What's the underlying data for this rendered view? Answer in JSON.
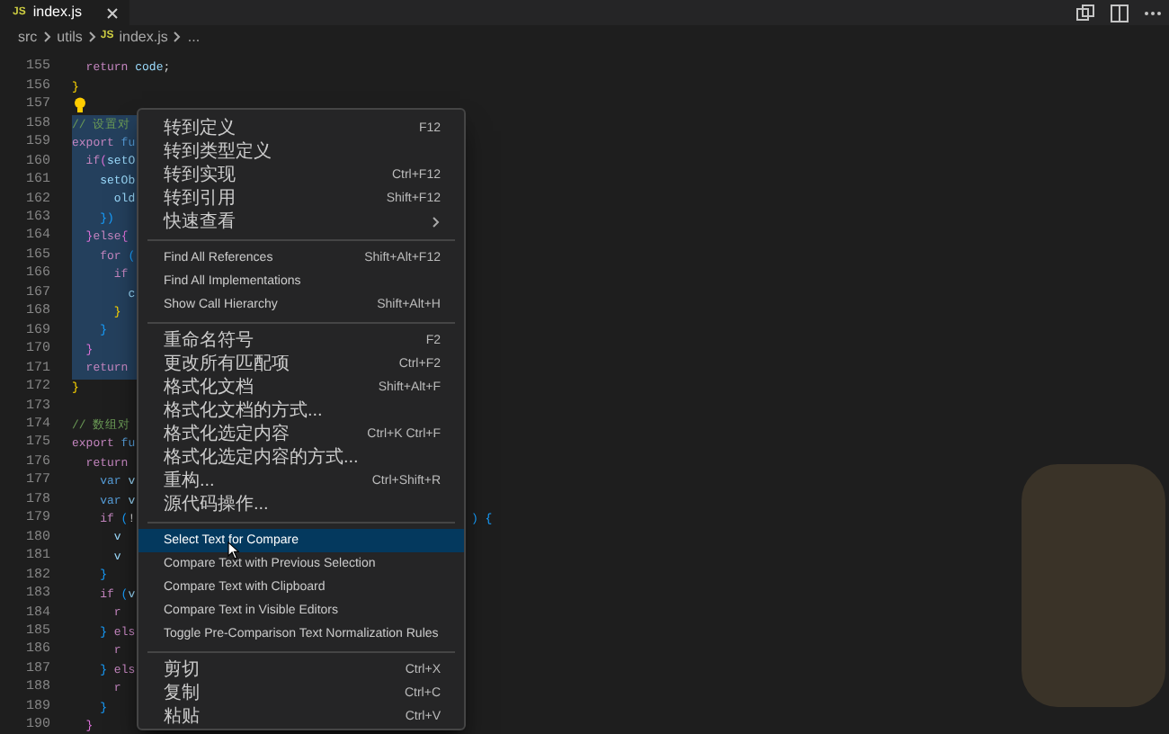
{
  "tabs": [
    {
      "icon_text": "JS",
      "label": "index.js",
      "selected": true
    }
  ],
  "breadcrumb": {
    "parts": [
      "src",
      "utils"
    ],
    "file_icon_text": "JS",
    "file": "index.js",
    "tail": "..."
  },
  "editor": {
    "lines": [
      {
        "number": "155",
        "selected": false,
        "tokens": [
          {
            "text": "  return",
            "kind": "keyword"
          },
          {
            "text": " code",
            "kind": "variable"
          },
          {
            "text": ";",
            "kind": "plain"
          }
        ]
      },
      {
        "number": "156",
        "selected": false,
        "tokens": [
          {
            "text": "}",
            "kind": "bracket1"
          }
        ]
      },
      {
        "number": "157",
        "selected": false,
        "lightbulb": true
      },
      {
        "number": "158",
        "selected": true,
        "tokens": [
          {
            "text": "// 设置对",
            "kind": "comment"
          }
        ]
      },
      {
        "number": "159",
        "selected": true,
        "tokens": [
          {
            "text": "export",
            "kind": "keyword"
          },
          {
            "text": " fu",
            "kind": "storage"
          }
        ]
      },
      {
        "number": "160",
        "selected": true,
        "tokens": [
          {
            "text": "  if",
            "kind": "keyword"
          },
          {
            "text": "(",
            "kind": "bracket2"
          },
          {
            "text": "setO",
            "kind": "variable"
          }
        ]
      },
      {
        "number": "161",
        "selected": true,
        "tokens": [
          {
            "text": "    setOb",
            "kind": "variable"
          }
        ]
      },
      {
        "number": "162",
        "selected": true,
        "tokens": [
          {
            "text": "      old",
            "kind": "variable"
          }
        ]
      },
      {
        "number": "163",
        "selected": true,
        "tokens": [
          {
            "text": "    })",
            "kind": "bracket3"
          }
        ]
      },
      {
        "number": "164",
        "selected": true,
        "tokens": [
          {
            "text": "  }",
            "kind": "bracket2"
          },
          {
            "text": "else",
            "kind": "keyword"
          },
          {
            "text": "{",
            "kind": "bracket2"
          }
        ]
      },
      {
        "number": "165",
        "selected": true,
        "tokens": [
          {
            "text": "    for",
            "kind": "keyword"
          },
          {
            "text": " (",
            "kind": "bracket3"
          }
        ]
      },
      {
        "number": "166",
        "selected": true,
        "tokens": [
          {
            "text": "      if",
            "kind": "keyword"
          }
        ]
      },
      {
        "number": "167",
        "selected": true,
        "tokens": [
          {
            "text": "        c",
            "kind": "variable"
          }
        ]
      },
      {
        "number": "168",
        "selected": true,
        "tokens": [
          {
            "text": "      }",
            "kind": "bracket1"
          }
        ]
      },
      {
        "number": "169",
        "selected": true,
        "tokens": [
          {
            "text": "    }",
            "kind": "bracket3"
          }
        ]
      },
      {
        "number": "170",
        "selected": true,
        "tokens": [
          {
            "text": "  }",
            "kind": "bracket2"
          }
        ]
      },
      {
        "number": "171",
        "selected": true,
        "tokens": [
          {
            "text": "  return",
            "kind": "keyword"
          }
        ]
      },
      {
        "number": "172",
        "selected": false,
        "tokens": [
          {
            "text": "}",
            "kind": "bracket1"
          }
        ]
      },
      {
        "number": "173",
        "selected": false
      },
      {
        "number": "174",
        "selected": false,
        "tokens": [
          {
            "text": "// 数组对",
            "kind": "comment"
          }
        ]
      },
      {
        "number": "175",
        "selected": false,
        "tokens": [
          {
            "text": "export",
            "kind": "keyword"
          },
          {
            "text": " fu",
            "kind": "storage"
          }
        ]
      },
      {
        "number": "176",
        "selected": false,
        "tokens": [
          {
            "text": "  return",
            "kind": "keyword"
          }
        ]
      },
      {
        "number": "177",
        "selected": false,
        "tokens": [
          {
            "text": "    var",
            "kind": "storage"
          },
          {
            "text": " v",
            "kind": "variable"
          }
        ]
      },
      {
        "number": "178",
        "selected": false,
        "tokens": [
          {
            "text": "    var",
            "kind": "storage"
          },
          {
            "text": " v",
            "kind": "variable"
          }
        ]
      },
      {
        "number": "179",
        "selected": false,
        "tokens": [
          {
            "text": "    if",
            "kind": "keyword"
          },
          {
            "text": " (",
            "kind": "bracket3"
          },
          {
            "text": "!",
            "kind": "plain"
          }
        ],
        "tail": ") {"
      },
      {
        "number": "180",
        "selected": false,
        "tokens": [
          {
            "text": "      v",
            "kind": "variable"
          }
        ]
      },
      {
        "number": "181",
        "selected": false,
        "tokens": [
          {
            "text": "      v",
            "kind": "variable"
          }
        ]
      },
      {
        "number": "182",
        "selected": false,
        "tokens": [
          {
            "text": "    }",
            "kind": "bracket3"
          }
        ]
      },
      {
        "number": "183",
        "selected": false,
        "tokens": [
          {
            "text": "    if",
            "kind": "keyword"
          },
          {
            "text": " (",
            "kind": "bracket3"
          },
          {
            "text": "v",
            "kind": "variable"
          }
        ]
      },
      {
        "number": "184",
        "selected": false,
        "tokens": [
          {
            "text": "      r",
            "kind": "keyword"
          }
        ]
      },
      {
        "number": "185",
        "selected": false,
        "tokens": [
          {
            "text": "    }",
            "kind": "bracket3"
          },
          {
            "text": " els",
            "kind": "keyword"
          }
        ]
      },
      {
        "number": "186",
        "selected": false,
        "tokens": [
          {
            "text": "      r",
            "kind": "keyword"
          }
        ]
      },
      {
        "number": "187",
        "selected": false,
        "tokens": [
          {
            "text": "    }",
            "kind": "bracket3"
          },
          {
            "text": " els",
            "kind": "keyword"
          }
        ]
      },
      {
        "number": "188",
        "selected": false,
        "tokens": [
          {
            "text": "      r",
            "kind": "keyword"
          }
        ]
      },
      {
        "number": "189",
        "selected": false,
        "tokens": [
          {
            "text": "    }",
            "kind": "bracket3"
          }
        ]
      },
      {
        "number": "190",
        "selected": false,
        "tokens": [
          {
            "text": "  }",
            "kind": "bracket2"
          }
        ]
      }
    ]
  },
  "context_menu": {
    "groups": [
      [
        {
          "label": "转到定义",
          "shortcut": "F12",
          "selected": false,
          "submenu": false
        },
        {
          "label": "转到类型定义",
          "selected": false,
          "submenu": false
        },
        {
          "label": "转到实现",
          "shortcut": "Ctrl+F12",
          "selected": false,
          "submenu": false
        },
        {
          "label": "转到引用",
          "shortcut": "Shift+F12",
          "selected": false,
          "submenu": false
        },
        {
          "label": "快速查看",
          "selected": false,
          "submenu": true
        }
      ],
      [
        {
          "label": "Find All References",
          "shortcut": "Shift+Alt+F12",
          "selected": false,
          "submenu": false
        },
        {
          "label": "Find All Implementations",
          "selected": false,
          "submenu": false
        },
        {
          "label": "Show Call Hierarchy",
          "shortcut": "Shift+Alt+H",
          "selected": false,
          "submenu": false
        }
      ],
      [
        {
          "label": "重命名符号",
          "shortcut": "F2",
          "selected": false,
          "submenu": false
        },
        {
          "label": "更改所有匹配项",
          "shortcut": "Ctrl+F2",
          "selected": false,
          "submenu": false
        },
        {
          "label": "格式化文档",
          "shortcut": "Shift+Alt+F",
          "selected": false,
          "submenu": false
        },
        {
          "label": "格式化文档的方式...",
          "selected": false,
          "submenu": false
        },
        {
          "label": "格式化选定内容",
          "shortcut": "Ctrl+K Ctrl+F",
          "selected": false,
          "submenu": false
        },
        {
          "label": "格式化选定内容的方式...",
          "selected": false,
          "submenu": false
        },
        {
          "label": "重构...",
          "shortcut": "Ctrl+Shift+R",
          "selected": false,
          "submenu": false
        },
        {
          "label": "源代码操作...",
          "selected": false,
          "submenu": false
        }
      ],
      [
        {
          "label": "Select Text for Compare",
          "selected": true,
          "submenu": false
        },
        {
          "label": "Compare Text with Previous Selection",
          "selected": false,
          "submenu": false
        },
        {
          "label": "Compare Text with Clipboard",
          "selected": false,
          "submenu": false
        },
        {
          "label": "Compare Text in Visible Editors",
          "selected": false,
          "submenu": false
        },
        {
          "label": "Toggle Pre-Comparison Text Normalization Rules",
          "selected": false,
          "submenu": false
        }
      ],
      [
        {
          "label": "剪切",
          "shortcut": "Ctrl+X",
          "selected": false,
          "submenu": false
        },
        {
          "label": "复制",
          "shortcut": "Ctrl+C",
          "selected": false,
          "submenu": false
        },
        {
          "label": "粘贴",
          "shortcut": "Ctrl+V",
          "selected": false,
          "submenu": false
        }
      ]
    ]
  }
}
